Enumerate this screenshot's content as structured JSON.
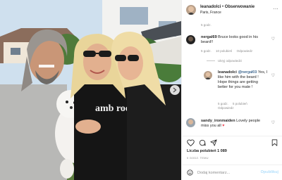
{
  "header": {
    "username": "leanadolci",
    "separator": "•",
    "follow_label": "Obserwowanie",
    "location": "Paris, France",
    "more_label": "..."
  },
  "post_time": "5 godz.",
  "comments": [
    {
      "user": "nergal69",
      "text": "Bruce looks good in his beard!!",
      "time": "5 godz.",
      "likes": "10 polubień",
      "reply_label": "Odpowiedz"
    },
    {
      "user": "leanadolci",
      "mention": "@nergal69",
      "text": "Yes, I like him with the beard ! Hope things are getting better for you mate !",
      "time": "5 godz.",
      "likes": "5 polubień",
      "reply_label": "Odpowiedz"
    },
    {
      "user": "sandy_ironmaiden",
      "text": "Lovely people miss you all",
      "time": "5 godz.",
      "reply_label": "Odpowiedz"
    }
  ],
  "hide_replies_label": "Ukryj odpowiedzi",
  "likes_label": "Liczba polubień 1 089",
  "posted_when": "5 GODZ. TEMU",
  "add_comment_placeholder": "Dodaj komentarz...",
  "publish_label": "Opublikuj",
  "photo": {
    "shirt_text": "amb rod"
  },
  "colors": {
    "link": "#00376b",
    "muted": "#8e8e8e",
    "publish_disabled": "#b2dffc",
    "heart": "#ed4956"
  }
}
